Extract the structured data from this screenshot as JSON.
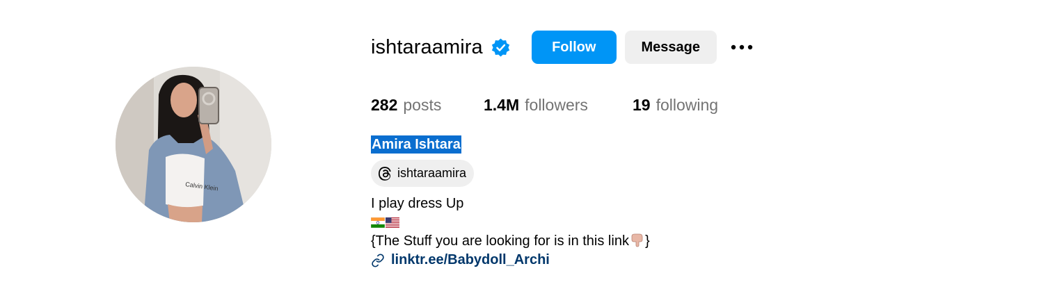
{
  "profile": {
    "username": "ishtaraamira",
    "verified": true,
    "full_name": "Amira Ishtara",
    "avatar_icon": "profile-photo"
  },
  "actions": {
    "follow_label": "Follow",
    "message_label": "Message",
    "more_icon": "more-options-icon"
  },
  "stats": {
    "posts_count": "282",
    "posts_label": "posts",
    "followers_count": "1.4M",
    "followers_label": "followers",
    "following_count": "19",
    "following_label": "following"
  },
  "threads": {
    "handle": "ishtaraamira",
    "icon": "threads-icon"
  },
  "bio": {
    "line1": "I play dress Up",
    "flags": [
      "india-flag",
      "usa-flag"
    ],
    "line3": "{The Stuff you are looking for is in this link",
    "line3_suffix": "}",
    "line3_emoji": "pointing-down-hand"
  },
  "link": {
    "text": "linktr.ee/Babydoll_Archi",
    "icon": "link-icon"
  },
  "colors": {
    "follow_bg": "#0095f6",
    "message_bg": "#efefef",
    "verified_blue": "#0095f6",
    "link_color": "#00376b",
    "muted_text": "#737373",
    "selection_highlight": "#0a6ecf"
  }
}
